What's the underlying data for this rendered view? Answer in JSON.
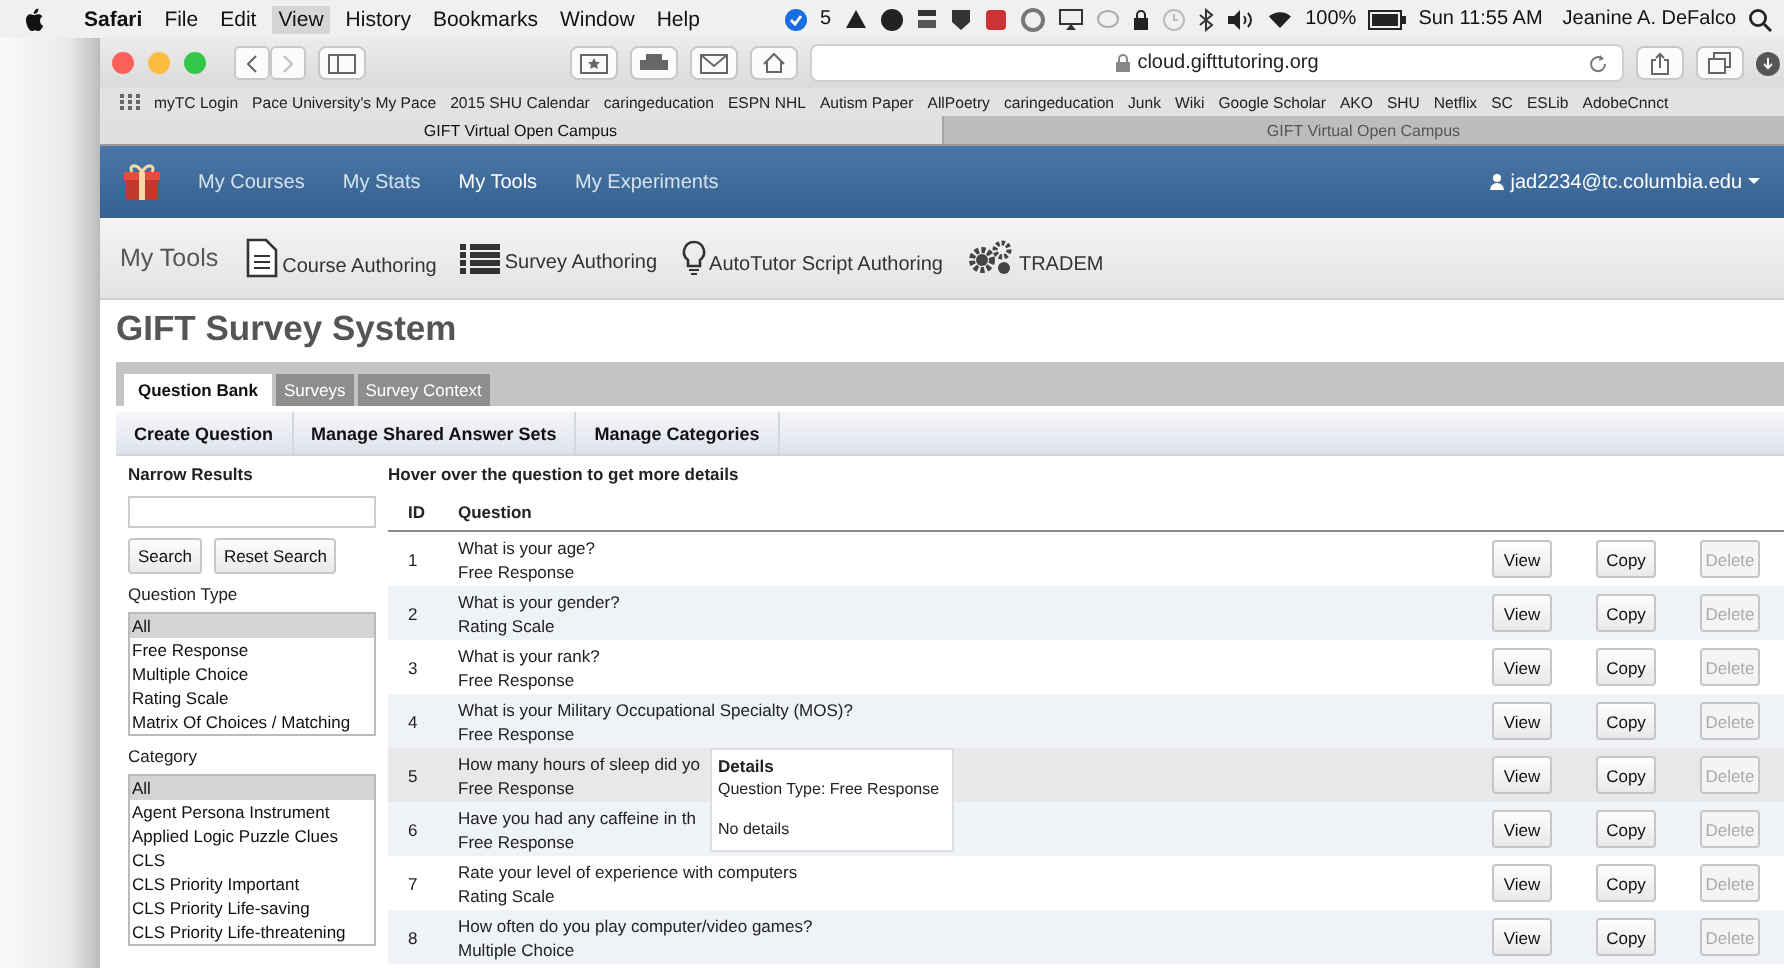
{
  "menu_bar": {
    "app": "Safari",
    "items": [
      {
        "label": "File",
        "selected": false
      },
      {
        "label": "Edit",
        "selected": false
      },
      {
        "label": "View",
        "selected": true
      },
      {
        "label": "History",
        "selected": false
      },
      {
        "label": "Bookmarks",
        "selected": false
      },
      {
        "label": "Window",
        "selected": false
      },
      {
        "label": "Help",
        "selected": false
      }
    ],
    "notification_count": "5",
    "battery": "100%",
    "clock": "Sun 11:55 AM",
    "user": "Jeanine A. DeFalco"
  },
  "browser": {
    "address": "cloud.gifttutoring.org",
    "bookmarks": [
      "myTC Login",
      "Pace University's My Pace",
      "2015 SHU Calendar",
      "caringeducation",
      "ESPN NHL",
      "Autism Paper",
      "AllPoetry",
      "caringeducation",
      "Junk",
      "Wiki",
      "Google Scholar",
      "AKO",
      "SHU",
      "Netflix",
      "SC",
      "ESLib",
      "AdobeCnnct"
    ],
    "tabs": [
      {
        "label": "GIFT Virtual Open Campus",
        "selected": true
      },
      {
        "label": "GIFT Virtual Open Campus",
        "selected": false
      }
    ]
  },
  "nav": {
    "items": [
      {
        "label": "My Courses",
        "selected": false
      },
      {
        "label": "My Stats",
        "selected": false
      },
      {
        "label": "My Tools",
        "selected": true
      },
      {
        "label": "My Experiments",
        "selected": false
      }
    ],
    "user": "jad2234@tc.columbia.edu"
  },
  "tools": {
    "title": "My Tools",
    "items": [
      {
        "label": "Course Authoring",
        "kind": "document"
      },
      {
        "label": "Survey Authoring",
        "kind": "list"
      },
      {
        "label": "AutoTutor Script Authoring",
        "kind": "bulb"
      },
      {
        "label": "TRADEM",
        "kind": "gears"
      }
    ]
  },
  "page_title": "GIFT Survey System",
  "tabs": [
    {
      "label": "Question Bank",
      "selected": true
    },
    {
      "label": "Surveys",
      "selected": false
    },
    {
      "label": "Survey Context",
      "selected": false
    }
  ],
  "actions": [
    "Create Question",
    "Manage Shared Answer Sets",
    "Manage Categories"
  ],
  "filters": {
    "title": "Narrow Results",
    "buttons": [
      "Search",
      "Reset Search"
    ],
    "question_type": {
      "label": "Question Type",
      "options": [
        {
          "label": "All",
          "selected": true
        },
        {
          "label": "Free Response",
          "selected": false
        },
        {
          "label": "Multiple Choice",
          "selected": false
        },
        {
          "label": "Rating Scale",
          "selected": false
        },
        {
          "label": "Matrix Of Choices / Matching",
          "selected": false
        }
      ]
    },
    "category": {
      "label": "Category",
      "options": [
        {
          "label": "All",
          "selected": true
        },
        {
          "label": "Agent Persona Instrument",
          "selected": false
        },
        {
          "label": "Applied Logic Puzzle Clues",
          "selected": false
        },
        {
          "label": "CLS",
          "selected": false
        },
        {
          "label": "CLS Priority Important",
          "selected": false
        },
        {
          "label": "CLS Priority Life-saving",
          "selected": false
        },
        {
          "label": "CLS Priority Life-threatening",
          "selected": false
        }
      ]
    }
  },
  "table": {
    "hint": "Hover over the question to get more details",
    "columns": [
      "ID",
      "Question"
    ],
    "rows": [
      {
        "id": "1",
        "question": "What is your age?",
        "type": "Free Response",
        "hovered": false,
        "buttons": [
          {
            "label": "View",
            "disabled": false
          },
          {
            "label": "Copy",
            "disabled": false
          },
          {
            "label": "Delete",
            "disabled": true
          }
        ]
      },
      {
        "id": "2",
        "question": "What is your gender?",
        "type": "Rating Scale",
        "hovered": false,
        "buttons": [
          {
            "label": "View",
            "disabled": false
          },
          {
            "label": "Copy",
            "disabled": false
          },
          {
            "label": "Delete",
            "disabled": true
          }
        ]
      },
      {
        "id": "3",
        "question": "What is your rank?",
        "type": "Free Response",
        "hovered": false,
        "buttons": [
          {
            "label": "View",
            "disabled": false
          },
          {
            "label": "Copy",
            "disabled": false
          },
          {
            "label": "Delete",
            "disabled": true
          }
        ]
      },
      {
        "id": "4",
        "question": "What is your Military Occupational Specialty (MOS)?",
        "type": "Free Response",
        "hovered": false,
        "buttons": [
          {
            "label": "View",
            "disabled": false
          },
          {
            "label": "Copy",
            "disabled": false
          },
          {
            "label": "Delete",
            "disabled": true
          }
        ]
      },
      {
        "id": "5",
        "question": "How many hours of sleep did yo",
        "type": "Free Response",
        "hovered": true,
        "buttons": [
          {
            "label": "View",
            "disabled": false
          },
          {
            "label": "Copy",
            "disabled": false
          },
          {
            "label": "Delete",
            "disabled": true
          }
        ]
      },
      {
        "id": "6",
        "question": "Have you had any caffeine in th",
        "type": "Free Response",
        "hovered": false,
        "buttons": [
          {
            "label": "View",
            "disabled": false
          },
          {
            "label": "Copy",
            "disabled": false
          },
          {
            "label": "Delete",
            "disabled": true
          }
        ]
      },
      {
        "id": "7",
        "question": "Rate your level of experience with computers",
        "type": "Rating Scale",
        "hovered": false,
        "buttons": [
          {
            "label": "View",
            "disabled": false
          },
          {
            "label": "Copy",
            "disabled": false
          },
          {
            "label": "Delete",
            "disabled": true
          }
        ]
      },
      {
        "id": "8",
        "question": "How often do you play computer/video games?",
        "type": "Multiple Choice",
        "hovered": false,
        "buttons": [
          {
            "label": "View",
            "disabled": false
          },
          {
            "label": "Copy",
            "disabled": false
          },
          {
            "label": "Delete",
            "disabled": true
          }
        ]
      }
    ],
    "tooltip": {
      "title": "Details",
      "lines": [
        "Question Type: Free Response",
        "No details"
      ]
    }
  }
}
